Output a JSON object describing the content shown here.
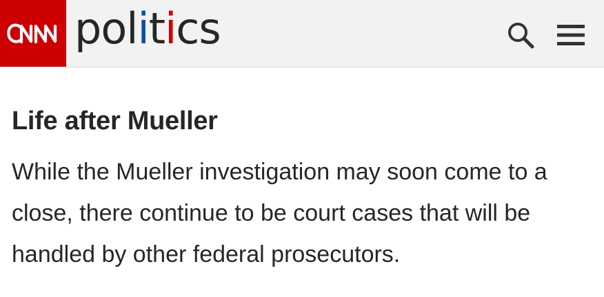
{
  "header": {
    "logo_text": "CNN",
    "section": {
      "part1": "pol",
      "i1": "i",
      "part2": "t",
      "i2": "i",
      "part3": "cs"
    },
    "search_icon": "search-icon",
    "menu_icon": "hamburger-menu-icon"
  },
  "article": {
    "headline": "Life after Mueller",
    "body": "While the Mueller investigation may soon come to a close, there continue to be court cases that will be handled by other federal prosecutors."
  },
  "colors": {
    "brand_red": "#cc0000",
    "politics_blue": "#0c4ea2",
    "header_bg": "#f2f2f2",
    "text": "#262626"
  }
}
